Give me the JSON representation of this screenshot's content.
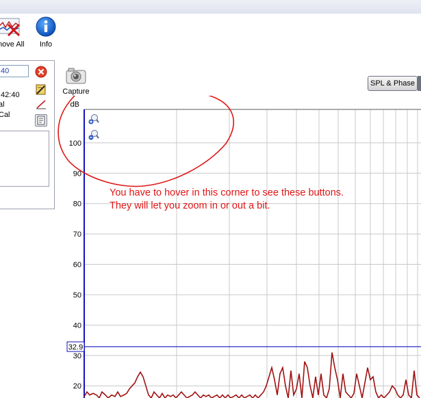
{
  "toolbar": {
    "remove_all_label": "move All",
    "info_label": "Info"
  },
  "left_panel": {
    "input_value": "40",
    "line1": ":42:40",
    "line2": "al",
    "line3": "Cal"
  },
  "capture_label": "Capture",
  "spl_phase_label": "SPL & Phase",
  "annotation": {
    "line1": "You have to hover in this corner to see these buttons.",
    "line2": "They will let you zoom in or out a bit."
  },
  "colors": {
    "axis": "#1010c0",
    "grid": "#c8c8c8",
    "trace": "#a01010",
    "annotation": "#e01515",
    "marker": "#1010c0"
  },
  "chart_data": {
    "type": "line",
    "ylabel": "dB",
    "yticks": [
      100,
      90,
      80,
      70,
      60,
      50,
      40,
      30,
      20
    ],
    "ylim": [
      16,
      111
    ],
    "grid": true,
    "marker": {
      "label": "32.9",
      "value": 32.9
    },
    "series": [
      {
        "x": [
          0,
          4,
          8,
          13,
          18,
          22,
          26,
          31,
          35,
          40,
          45,
          49,
          53,
          58,
          62,
          66,
          70,
          74,
          78,
          82,
          86,
          90,
          94,
          98,
          102,
          106,
          110,
          114,
          118,
          122,
          126,
          130,
          134,
          138,
          142,
          146,
          150,
          154,
          158,
          162,
          166,
          170,
          174,
          178,
          182,
          186,
          190,
          194,
          198,
          202,
          206,
          210,
          214,
          218,
          222,
          226,
          230,
          234,
          238,
          242,
          246,
          250,
          254,
          258,
          262,
          266,
          270,
          274,
          278,
          282,
          286,
          290,
          294,
          298,
          302,
          306,
          310,
          314,
          318,
          322,
          326,
          330,
          334,
          338,
          342,
          346,
          350,
          354,
          358,
          362,
          366,
          370,
          374,
          378,
          382,
          386,
          390,
          394,
          398,
          402,
          406,
          410,
          414,
          418,
          422,
          426,
          430,
          434,
          438,
          442,
          446,
          450,
          454,
          458,
          462,
          466,
          470,
          474,
          478,
          482,
          486,
          490
        ],
        "y": [
          16.5,
          18,
          17,
          17.5,
          17,
          16,
          18,
          17,
          16,
          17,
          16.5,
          18,
          16.5,
          17,
          17.5,
          19,
          20,
          21,
          23,
          24.5,
          23,
          20,
          17,
          16,
          18,
          17,
          16,
          17.5,
          16,
          17,
          16.5,
          17,
          16,
          17,
          18,
          17,
          16,
          16.5,
          17,
          18,
          17,
          16,
          17,
          16.5,
          17,
          16,
          16.5,
          17,
          16,
          17,
          16,
          17,
          16,
          16.5,
          17,
          16,
          17,
          16,
          16.5,
          17,
          16,
          17,
          16,
          17,
          18,
          20,
          23,
          26,
          22,
          17,
          24,
          26,
          20,
          16,
          25,
          17,
          19,
          24,
          16,
          28,
          26,
          20,
          16,
          23,
          17,
          24,
          17,
          16,
          19,
          31,
          26,
          22,
          16,
          24,
          18,
          17,
          16,
          17.5,
          24,
          20,
          16,
          21,
          26,
          22,
          23,
          18,
          16,
          17,
          16,
          17,
          18,
          20,
          19,
          17,
          16,
          17,
          22,
          17,
          16,
          25,
          17,
          16
        ]
      }
    ]
  }
}
